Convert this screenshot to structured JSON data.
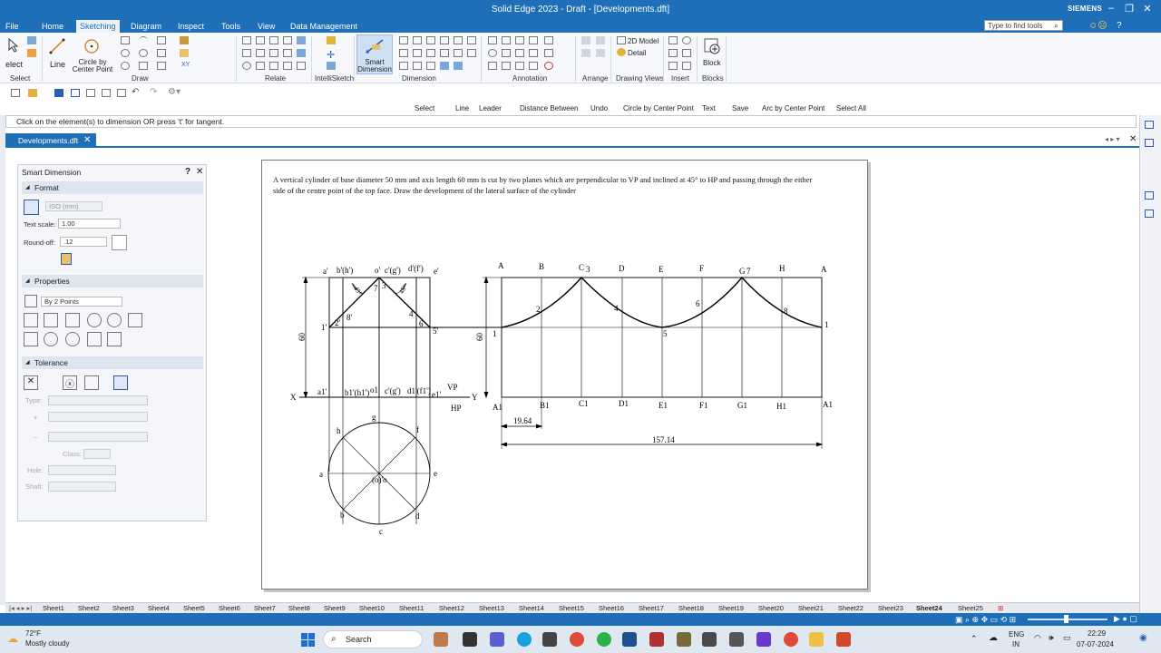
{
  "window": {
    "title": "Solid Edge 2023 - Draft - [Developments.dft]",
    "brand": "SIEMENS",
    "search_placeholder": "Type to find tools"
  },
  "menu": {
    "file": "File",
    "tabs": [
      "Home",
      "Sketching",
      "Diagram",
      "Inspect",
      "Tools",
      "View",
      "Data Management"
    ],
    "active_tab": "Sketching"
  },
  "ribbon": {
    "select": "elect",
    "line": "Line",
    "circle_by_center": "Circle by\nCenter Point",
    "smart_dimension": "Smart\nDimension",
    "model_2d": "2D Model",
    "detail": "Detail",
    "block": "Block",
    "groups": [
      "Select",
      "Draw",
      "Relate",
      "IntelliSketch",
      "Dimension",
      "Annotation",
      "Arrange",
      "Drawing Views",
      "Insert",
      "Blocks"
    ]
  },
  "command_bar": [
    "Select",
    "Line",
    "Leader",
    "Distance Between",
    "Undo",
    "Circle by Center Point",
    "Text",
    "Save",
    "Arc by Center Point",
    "Select All"
  ],
  "prompt": "Click on the element(s) to dimension OR press 't' for tangent.",
  "document_tab": "Developments.dft",
  "panel": {
    "title": "Smart Dimension",
    "sections": {
      "format": "Format",
      "properties": "Properties",
      "tolerance": "Tolerance"
    },
    "standard": "ISO (mm)",
    "text_scale_label": "Text scale:",
    "text_scale": "1.00",
    "round_off_label": "Round-off:",
    "round_off": ".12",
    "by_points": "By 2 Points",
    "type_label": "Type:",
    "class_label": "Class:",
    "hole_label": "Hole:",
    "shaft_label": "Shaft:"
  },
  "sheet": {
    "problem": "A vertical cylinder of base diameter 50 mm and axis length 60 mm is cut by two planes which are perpendicular to VP and inclined at 45° to HP and passing through the either side of the centre point of the top face. Draw the development of the lateral surface of the cylinder"
  },
  "drawing": {
    "front_top": [
      "a'",
      "b'(h')",
      "o'",
      "c'(g')",
      "d'(f')",
      "e'"
    ],
    "front_bottom": [
      "a1'",
      "b1'(h1')",
      "o1",
      "c'(g')",
      "d1'(f1')",
      "e1'"
    ],
    "front_points": [
      "1'",
      "2'",
      "8'",
      "7",
      "3",
      "4",
      "6",
      "5'"
    ],
    "front_angles": [
      "45°",
      "45°"
    ],
    "front_height": "60",
    "xy": [
      "X",
      "Y",
      "VP",
      "HP"
    ],
    "plan": [
      "g",
      "h",
      "f",
      "a",
      "e",
      "b",
      "d",
      "c",
      "(o)'o"
    ],
    "dev_top": [
      "A",
      "B",
      "C",
      "D",
      "E",
      "F",
      "G",
      "H",
      "A"
    ],
    "dev_bottom": [
      "A1",
      "B1",
      "C1",
      "D1",
      "E1",
      "F1",
      "G1",
      "H1",
      "A1"
    ],
    "dev_curve_points": [
      "1",
      "2",
      "3",
      "4",
      "5",
      "6",
      "7",
      "8",
      "1"
    ],
    "dev_height": "60",
    "dim_division": "19.64",
    "dim_total": "157.14"
  },
  "sheet_tabs": [
    "Sheet1",
    "Sheet2",
    "Sheet3",
    "Sheet4",
    "Sheet5",
    "Sheet6",
    "Sheet7",
    "Sheet8",
    "Sheet9",
    "Sheet10",
    "Sheet11",
    "Sheet12",
    "Sheet13",
    "Sheet14",
    "Sheet15",
    "Sheet16",
    "Sheet17",
    "Sheet18",
    "Sheet19",
    "Sheet20",
    "Sheet21",
    "Sheet22",
    "Sheet23",
    "Sheet24",
    "Sheet25"
  ],
  "active_sheet": "Sheet24",
  "taskbar": {
    "weather_temp": "72°F",
    "weather_desc": "Mostly cloudy",
    "search": "Search",
    "lang1": "ENG",
    "lang2": "IN",
    "time": "22:29",
    "date": "07-07-2024"
  }
}
